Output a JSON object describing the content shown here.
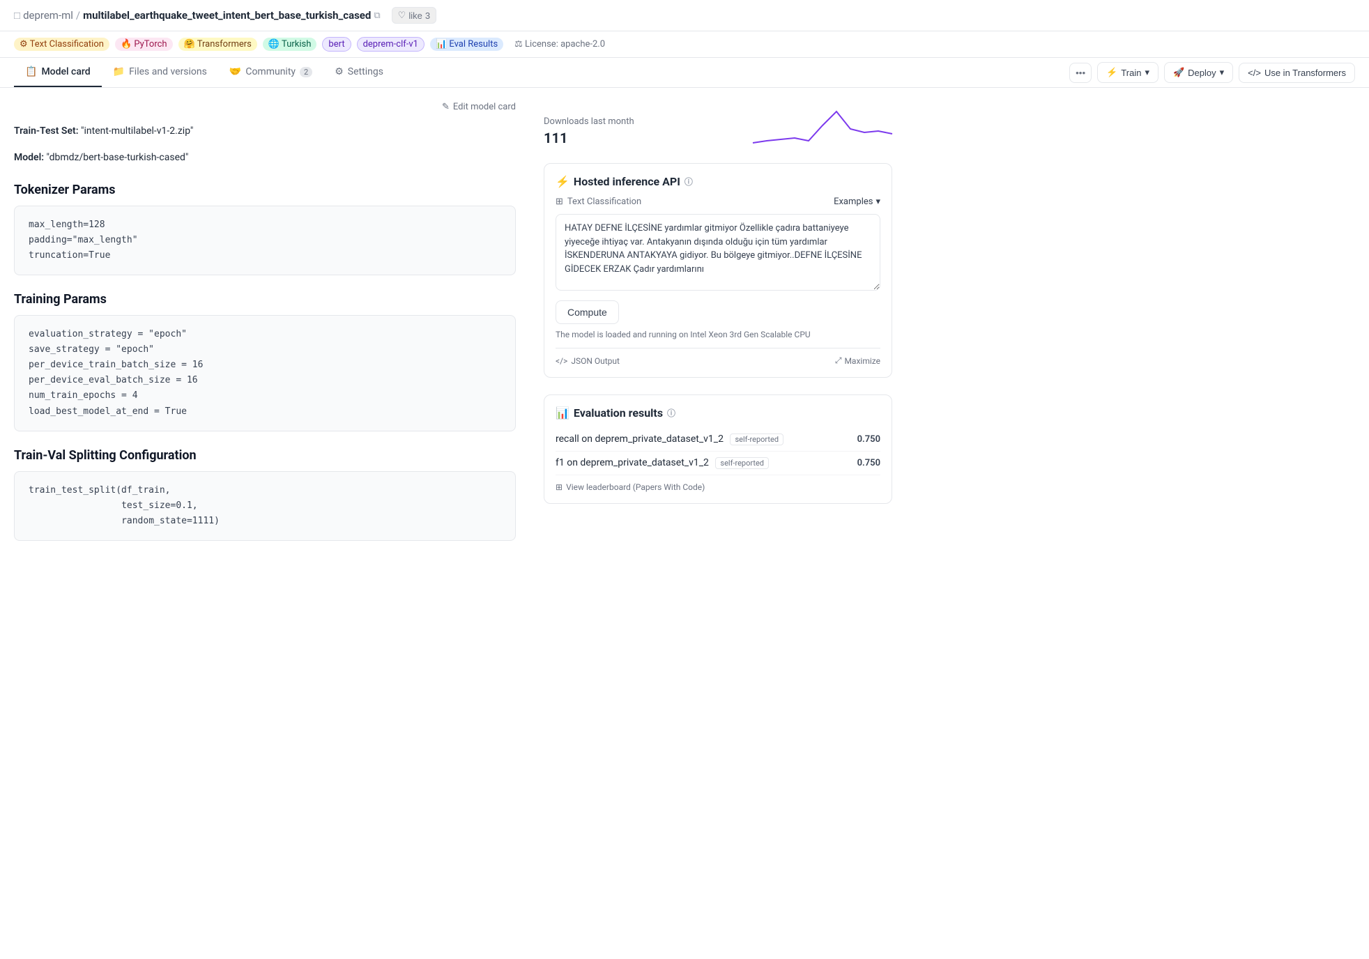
{
  "header": {
    "org": "deprem-ml",
    "separator": "/",
    "model_name": "multilabel_earthquake_tweet_intent_bert_base_turkish_cased",
    "like_label": "like",
    "like_count": "3"
  },
  "tags": [
    {
      "id": "task",
      "icon": "⚙",
      "label": "Text Classification",
      "class": "tag-task"
    },
    {
      "id": "pytorch",
      "icon": "🔥",
      "label": "PyTorch",
      "class": "tag-pytorch"
    },
    {
      "id": "transformers",
      "icon": "🤗",
      "label": "Transformers",
      "class": "tag-transformers"
    },
    {
      "id": "turkish",
      "icon": "🌐",
      "label": "Turkish",
      "class": "tag-turkish"
    },
    {
      "id": "bert",
      "icon": "",
      "label": "bert",
      "class": "tag-bert"
    },
    {
      "id": "deprem",
      "icon": "",
      "label": "deprem-clf-v1",
      "class": "tag-deprem"
    },
    {
      "id": "eval",
      "icon": "📊",
      "label": "Eval Results",
      "class": "tag-eval"
    },
    {
      "id": "license",
      "icon": "⚖",
      "label": "License: apache-2.0",
      "class": "tag-license"
    }
  ],
  "nav": {
    "tabs": [
      {
        "id": "model-card",
        "label": "Model card",
        "icon": "📋",
        "active": true
      },
      {
        "id": "files-versions",
        "label": "Files and versions",
        "icon": "📁",
        "active": false
      },
      {
        "id": "community",
        "label": "Community",
        "icon": "🤝",
        "badge": "2",
        "active": false
      },
      {
        "id": "settings",
        "label": "Settings",
        "icon": "⚙",
        "active": false
      }
    ],
    "buttons": {
      "train": "Train",
      "deploy": "Deploy",
      "use_in_transformers": "Use in Transformers"
    }
  },
  "main": {
    "edit_label": "Edit model card",
    "train_test_set_label": "Train-Test Set:",
    "train_test_set_value": "\"intent-multilabel-v1-2.zip\"",
    "model_label": "Model:",
    "model_value": "\"dbmdz/bert-base-turkish-cased\"",
    "tokenizer_heading": "Tokenizer Params",
    "tokenizer_code": "max_length=128\npadding=\"max_length\"\ntruncation=True",
    "training_heading": "Training Params",
    "training_code": "evaluation_strategy = \"epoch\"\nsave_strategy = \"epoch\"\nper_device_train_batch_size = 16\nper_device_eval_batch_size = 16\nnum_train_epochs = 4\nload_best_model_at_end = True",
    "splitting_heading": "Train-Val Splitting Configuration",
    "splitting_code": "train_test_split(df_train,\n                 test_size=0.1,\n                 random_state=1111)"
  },
  "right": {
    "downloads_label": "Downloads last month",
    "downloads_count": "111",
    "inference": {
      "heading": "Hosted inference API",
      "task_label": "Text Classification",
      "examples_label": "Examples",
      "textarea_value": "HATAY DEFNE İLÇESİNE yardımlar gitmiyor Özellikle çadıra battaniyeye yiyeceğe ihtiyaç var. Antakyanın dışında olduğu için tüm yardımlar  İSKENDERUNA ANTAKYAYA gidiyor. Bu bölgeye gitmiyor..DEFNE İLÇESİNE GİDECEK ERZAK Çadır yardımlarını",
      "compute_label": "Compute",
      "running_text": "The model is loaded and running on Intel Xeon 3rd Gen Scalable CPU",
      "json_output_label": "JSON Output",
      "maximize_label": "Maximize"
    },
    "evaluation": {
      "heading": "Evaluation results",
      "rows": [
        {
          "metric": "recall on deprem_private_dataset_v1_2",
          "badge": "self-reported",
          "value": "0.750"
        },
        {
          "metric": "f1 on deprem_private_dataset_v1_2",
          "badge": "self-reported",
          "value": "0.750"
        }
      ],
      "leaderboard_label": "View leaderboard (Papers With Code)"
    }
  }
}
